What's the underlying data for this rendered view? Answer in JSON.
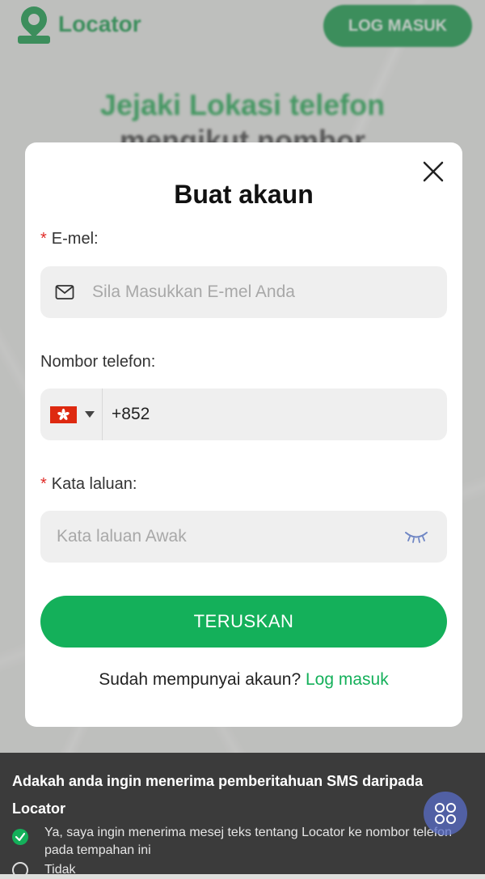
{
  "background": {
    "brand": "Locator",
    "login_button": "LOG MASUK",
    "hero_line1": "Jejaki Lokasi telefon",
    "hero_line2": "mengikut nombor"
  },
  "modal": {
    "title": "Buat akaun",
    "email": {
      "label": "E-mel:",
      "required_mark": "*",
      "placeholder": "Sila Masukkan E-mel Anda"
    },
    "phone": {
      "label": "Nombor telefon:",
      "country_flag": "hong-kong-flag",
      "value": "+852"
    },
    "password": {
      "label": "Kata laluan:",
      "required_mark": "*",
      "placeholder": "Kata laluan Awak"
    },
    "submit_label": "TERUSKAN",
    "footer_prompt": "Sudah mempunyai akaun?",
    "footer_link": "Log masuk"
  },
  "sms_panel": {
    "question": "Adakah anda ingin menerima pemberitahuan SMS daripada Locator",
    "options": [
      {
        "label": "Ya, saya ingin menerima mesej teks tentang Locator ke nombor telefon pada tempahan ini",
        "selected": true
      },
      {
        "label": "Tidak",
        "selected": false
      }
    ]
  },
  "colors": {
    "accent": "#14b05a",
    "required": "#e02b27",
    "panel_bg": "#3b3b3b"
  }
}
